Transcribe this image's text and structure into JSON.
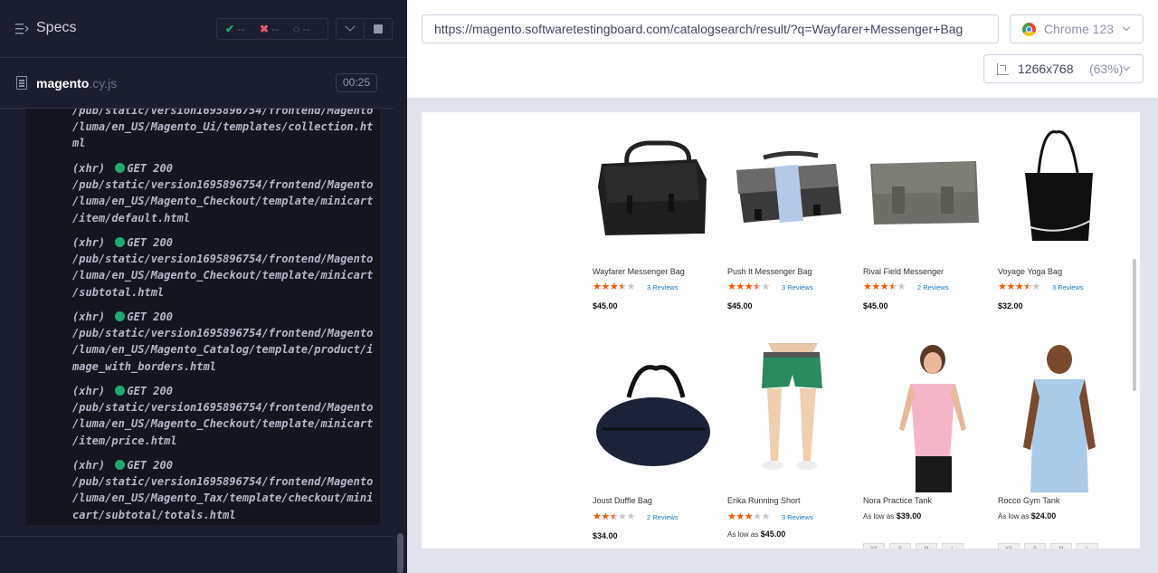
{
  "runner": {
    "specs_title": "Specs",
    "stats": {
      "passed": "--",
      "failed": "--",
      "pending": "--"
    },
    "spec_file": {
      "name": "magento",
      "ext": ".cy.js",
      "timer": "00:25"
    },
    "log_top_fragment": "/pub/static/version1695896754/frontend/Magento\n/luma/en_US/Magento_Ui/templates/collection.ht\nml",
    "log_entries": [
      {
        "prefix": "(xhr)",
        "method": "GET 200",
        "path": "/pub/static/version1695896754/frontend/Magento\n/luma/en_US/Magento_Checkout/template/minicart\n/item/default.html"
      },
      {
        "prefix": "(xhr)",
        "method": "GET 200",
        "path": "/pub/static/version1695896754/frontend/Magento\n/luma/en_US/Magento_Checkout/template/minicart\n/subtotal.html"
      },
      {
        "prefix": "(xhr)",
        "method": "GET 200",
        "path": "/pub/static/version1695896754/frontend/Magento\n/luma/en_US/Magento_Catalog/template/product/i\nmage_with_borders.html"
      },
      {
        "prefix": "(xhr)",
        "method": "GET 200",
        "path": "/pub/static/version1695896754/frontend/Magento\n/luma/en_US/Magento_Checkout/template/minicart\n/item/price.html"
      },
      {
        "prefix": "(xhr)",
        "method": "GET 200",
        "path": "/pub/static/version1695896754/frontend/Magento\n/luma/en_US/Magento_Tax/template/checkout/mini\ncart/subtotal/totals.html"
      }
    ],
    "status_color": "#1fa971"
  },
  "browser": {
    "url": "https://magento.softwaretestingboard.com/catalogsearch/result/?q=Wayfarer+Messenger+Bag",
    "browser_name": "Chrome 123",
    "viewport": "1266x768",
    "zoom": "(63%)"
  },
  "products": [
    {
      "name": "Wayfarer Messenger Bag",
      "rating": 3,
      "half": true,
      "reviews": "3 Reviews",
      "price": "$45.00",
      "as_low_as": ""
    },
    {
      "name": "Push It Messenger Bag",
      "rating": 3,
      "half": true,
      "reviews": "3 Reviews",
      "price": "$45.00",
      "as_low_as": ""
    },
    {
      "name": "Rival Field Messenger",
      "rating": 3,
      "half": true,
      "reviews": "2 Reviews",
      "price": "$45.00",
      "as_low_as": ""
    },
    {
      "name": "Voyage Yoga Bag",
      "rating": 3,
      "half": true,
      "reviews": "3 Reviews",
      "price": "$32.00",
      "as_low_as": ""
    },
    {
      "name": "Joust Duffle Bag",
      "rating": 2,
      "half": true,
      "reviews": "2 Reviews",
      "price": "$34.00",
      "as_low_as": ""
    },
    {
      "name": "Erika Running Short",
      "rating": 3,
      "half": false,
      "reviews": "3 Reviews",
      "price": "$45.00",
      "as_low_as": "As low as"
    },
    {
      "name": "Nora Practice Tank",
      "rating": 0,
      "half": false,
      "reviews": "",
      "price": "$39.00",
      "as_low_as": "As low as"
    },
    {
      "name": "Rocco Gym Tank",
      "rating": 0,
      "half": false,
      "reviews": "",
      "price": "$24.00",
      "as_low_as": "As low as"
    }
  ],
  "sizes": [
    "XS",
    "S",
    "M",
    "L"
  ]
}
